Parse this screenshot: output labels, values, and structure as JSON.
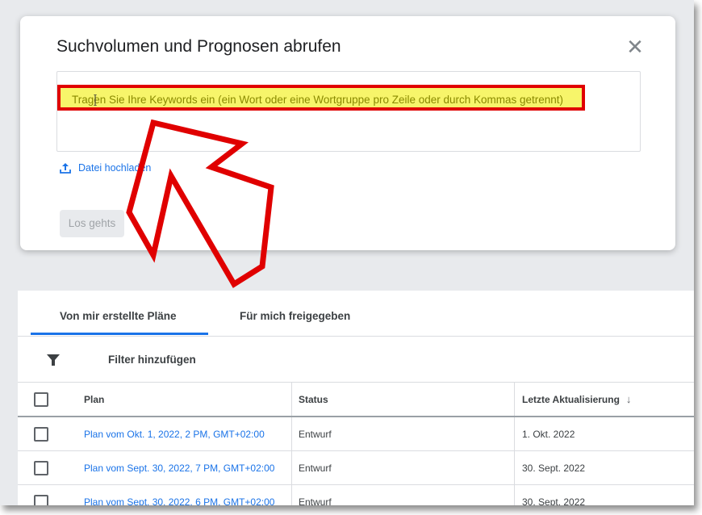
{
  "dialog": {
    "title": "Suchvolumen und Prognosen abrufen",
    "close_label": "✕",
    "keywords_placeholder": "Tragen Sie Ihre Keywords ein (ein Wort oder eine Wortgruppe pro Zeile oder durch Kommas getrennt)",
    "upload_label": "Datei hochladen",
    "go_label": "Los gehts"
  },
  "tabs": [
    {
      "label": "Von mir erstellte Pläne",
      "active": true
    },
    {
      "label": "Für mich freigegeben",
      "active": false
    }
  ],
  "filter": {
    "label": "Filter hinzufügen"
  },
  "table": {
    "headers": {
      "plan": "Plan",
      "status": "Status",
      "updated": "Letzte Aktualisierung",
      "sort_icon": "↓"
    },
    "rows": [
      {
        "plan": "Plan vom Okt. 1, 2022, 2 PM, GMT+02:00",
        "status": "Entwurf",
        "updated": "1. Okt. 2022"
      },
      {
        "plan": "Plan vom Sept. 30, 2022, 7 PM, GMT+02:00",
        "status": "Entwurf",
        "updated": "30. Sept. 2022"
      },
      {
        "plan": "Plan vom Sept. 30, 2022, 6 PM, GMT+02:00",
        "status": "Entwurf",
        "updated": "30. Sept. 2022"
      }
    ]
  },
  "colors": {
    "accent": "#1a73e8",
    "highlight": "#f7f56a",
    "annotation_red": "#e00000"
  },
  "icons": {
    "close": "close-icon",
    "upload": "upload-icon",
    "filter": "filter-icon",
    "sort": "arrow-down-icon",
    "annotation": "red-arrow-annotation"
  }
}
